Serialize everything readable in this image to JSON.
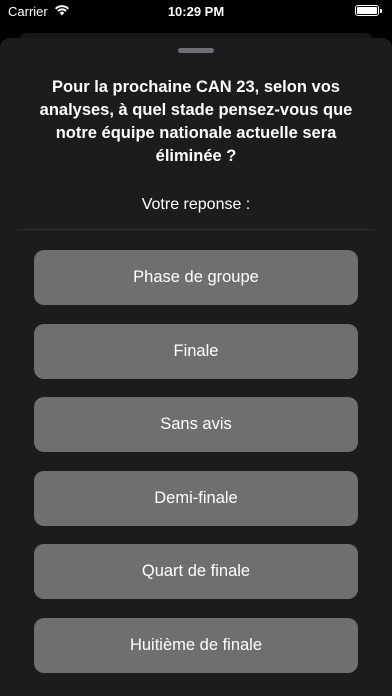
{
  "status_bar": {
    "carrier": "Carrier",
    "time": "10:29 PM",
    "wifi_icon": "wifi-icon",
    "battery_icon": "battery-full-icon",
    "battery_level": 1.0
  },
  "sheet": {
    "question": "Pour la prochaine CAN 23, selon vos analyses, à quel stade pensez-vous que notre équipe nationale actuelle sera éliminée ?",
    "answer_label": "Votre reponse :",
    "options": [
      "Phase de groupe",
      "Finale",
      "Sans avis",
      "Demi-finale",
      "Quart de finale",
      "Huitième de finale"
    ]
  },
  "colors": {
    "background": "#000000",
    "sheet": "#1c1c1e",
    "button": "#6f6f70",
    "text": "#ffffff"
  }
}
